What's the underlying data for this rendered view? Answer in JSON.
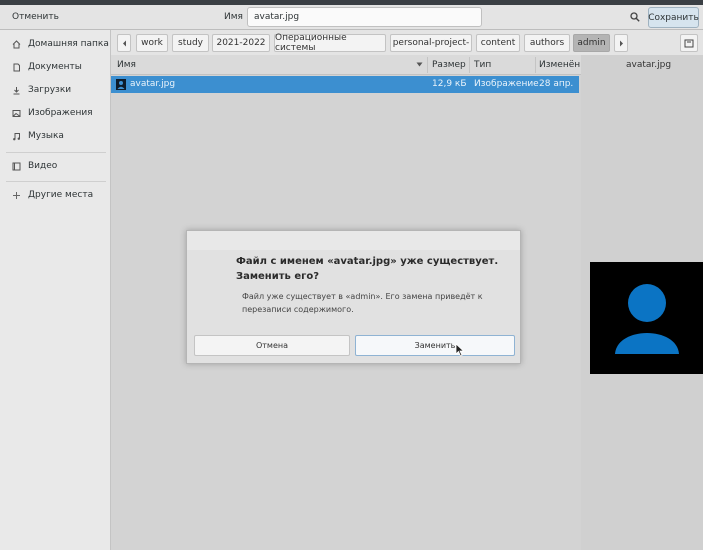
{
  "titlebar": {
    "cancel_label": "Отменить",
    "name_label": "Имя",
    "filename_value": "avatar.jpg",
    "search_icon": "search-icon",
    "save_label": "Сохранить"
  },
  "sidebar": {
    "items": [
      {
        "label": "Домашняя папка",
        "icon": "home-icon"
      },
      {
        "label": "Документы",
        "icon": "document-icon"
      },
      {
        "label": "Загрузки",
        "icon": "download-icon"
      },
      {
        "label": "Изображения",
        "icon": "image-icon"
      },
      {
        "label": "Музыка",
        "icon": "music-icon"
      },
      {
        "label": "Видео",
        "icon": "video-icon"
      },
      {
        "label": "Другие места",
        "icon": "plus-icon"
      }
    ]
  },
  "pathbar": {
    "crumbs": [
      "work",
      "study",
      "2021-2022",
      "Операционные системы",
      "personal-project-",
      "content",
      "authors",
      "admin"
    ],
    "active_crumb": "admin"
  },
  "filelist": {
    "columns": [
      "Имя",
      "Размер",
      "Тип",
      "Изменён"
    ],
    "rows": [
      {
        "name": "avatar.jpg",
        "size": "12,9 кБ",
        "type": "Изображение",
        "modified": "28 апр.",
        "selected": true
      }
    ]
  },
  "preview": {
    "name": "avatar.jpg",
    "avatar_color": "#0b74c4"
  },
  "dialog": {
    "title": "Файл с именем «avatar.jpg» уже существует. Заменить его?",
    "message": "Файл уже существует в «admin». Его замена приведёт к перезаписи содержимого.",
    "cancel_label": "Отмена",
    "replace_label": "Заменить"
  },
  "colors": {
    "selection": "#3c8fd0",
    "save_button": "#d6e4ee"
  }
}
